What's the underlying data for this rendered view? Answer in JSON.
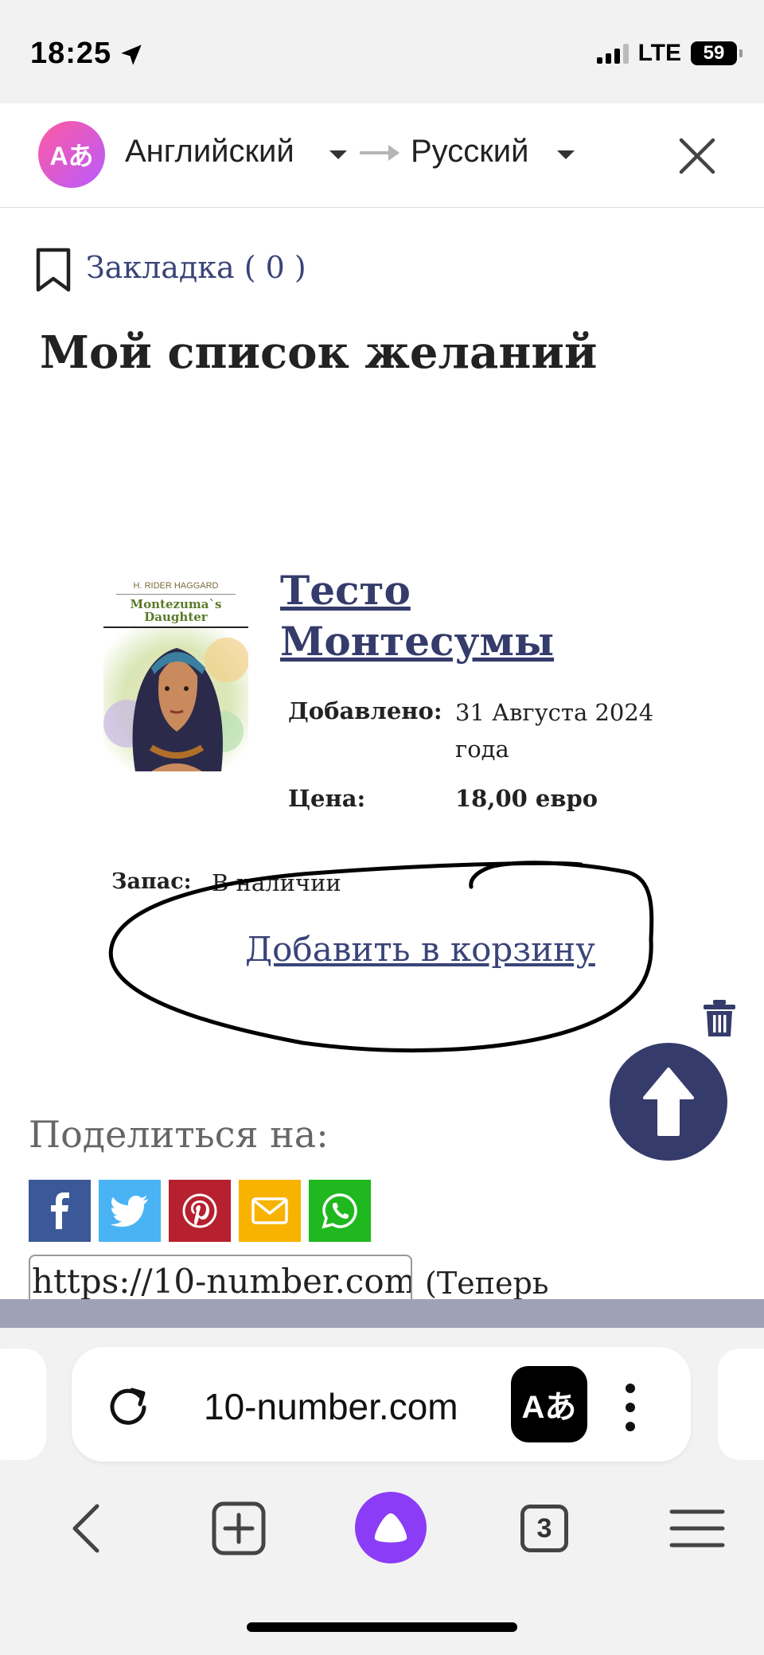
{
  "status_bar": {
    "time": "18:25",
    "network": "LTE",
    "battery": "59"
  },
  "translate_bar": {
    "source_language": "Английский",
    "target_language": "Русский"
  },
  "page": {
    "bookmark": "Закладка ( 0 )",
    "title": "Мой список желаний",
    "product": {
      "cover": {
        "author": "H. RIDER HAGGARD",
        "title_line1": "Montezuma`s",
        "title_line2": "Daughter"
      },
      "title_line1": "Тесто",
      "title_line2": "Монтесумы",
      "added_label": "Добавлено:",
      "added_line1": "31 Августа 2024",
      "added_line2": "года",
      "price_label": "Цена:",
      "price_value": "18,00 евро",
      "stock_label": "Запас:",
      "stock_value": "В наличии",
      "add_to_cart": "Добавить в корзину"
    },
    "share": {
      "label": "Поделиться на:",
      "buttons": [
        {
          "name": "facebook",
          "color": "#3b5998"
        },
        {
          "name": "twitter",
          "color": "#4ab3f4"
        },
        {
          "name": "pinterest",
          "color": "#b7202e"
        },
        {
          "name": "email",
          "color": "#f8b200"
        },
        {
          "name": "whatsapp",
          "color": "#1fb81f"
        }
      ],
      "url": "https://10-number.com",
      "trailing": "(Теперь"
    }
  },
  "browser": {
    "address": "10-number.com",
    "tab_count": "3"
  },
  "colors": {
    "link": "#3a4478",
    "accent": "#353b6b",
    "alice": "#8b3cf7"
  }
}
